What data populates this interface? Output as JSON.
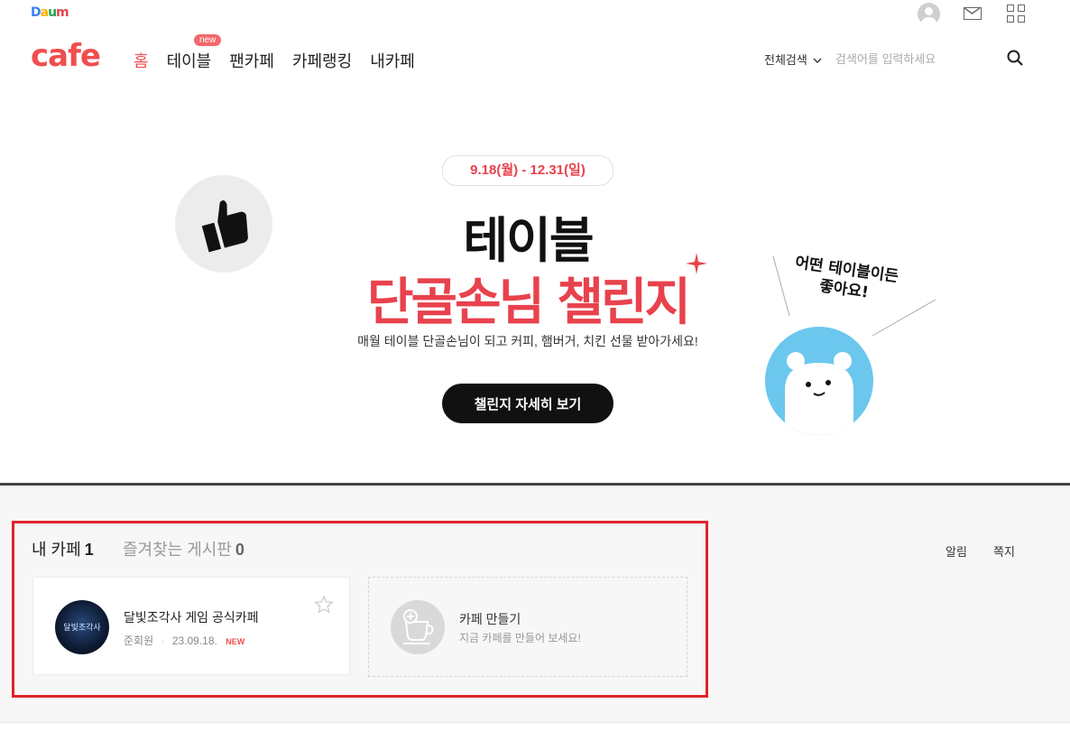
{
  "header": {
    "daum_logo": "Daum",
    "cafe_logo": "cafe",
    "nav": [
      {
        "label": "홈",
        "active": true
      },
      {
        "label": "테이블",
        "active": false
      },
      {
        "label": "팬카페",
        "active": false
      },
      {
        "label": "카페랭킹",
        "active": false
      },
      {
        "label": "내카페",
        "active": false
      }
    ],
    "new_badge": "new",
    "search_scope": "전체검색",
    "search_placeholder": "검색어를 입력하세요",
    "icons": [
      "profile-icon",
      "mail-icon",
      "apps-icon",
      "search-icon"
    ]
  },
  "banner": {
    "date": "9.18(월) - 12.31(일)",
    "title_line1": "테이블",
    "title_line2": "단골손님 챌린지",
    "subtitle": "매월 테이블 단골손님이 되고 커피, 햄버거, 치킨 선물 받아가세요!",
    "button": "챌린지 자세히 보기",
    "speech": "어떤 테이블이든\n좋아요!",
    "colors": {
      "accent": "#e8424d",
      "bear_bg": "#6cc7ee"
    }
  },
  "mycafe": {
    "tab_mycafe_label": "내 카페",
    "tab_mycafe_count": "1",
    "tab_fav_label": "즐겨찾는 게시판",
    "tab_fav_count": "0",
    "right_links": [
      "알림",
      "쪽지"
    ],
    "cafes": [
      {
        "name": "달빛조각사 게임 공식카페",
        "role": "준회원",
        "date": "23.09.18.",
        "badge": "NEW",
        "thumb_text": "달빛조각사"
      }
    ],
    "create": {
      "title": "카페 만들기",
      "subtitle": "지금 카페를 만들어 보세요!"
    }
  }
}
